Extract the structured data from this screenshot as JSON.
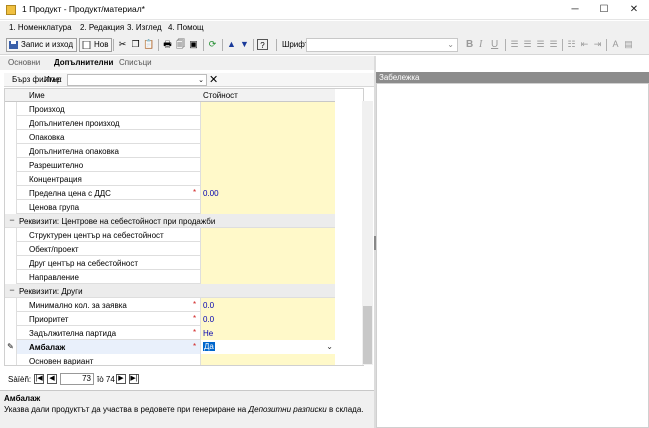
{
  "window": {
    "title": "1 Продукт - Продукт/материал*",
    "minimize": "─",
    "maximize": "☐",
    "close": "✕"
  },
  "menu": [
    {
      "label": "1. Номенклатура"
    },
    {
      "label": "2. Редакция"
    },
    {
      "label": "3. Изглед"
    },
    {
      "label": "4. Помощ"
    }
  ],
  "toolbar": {
    "save_exit": "Запис и изход",
    "new": "Нов",
    "font_label": "Шрифт:",
    "font_value": "",
    "fmt": [
      "B",
      "I",
      "U"
    ]
  },
  "tabs": [
    {
      "label": "Основни",
      "active": false
    },
    {
      "label": "Допълнителни",
      "active": true
    },
    {
      "label": "Списъци",
      "active": false
    }
  ],
  "filter": {
    "quick_filter": "Бърз филтър",
    "name_label": "Име:",
    "name_value": ""
  },
  "grid": {
    "columns": [
      "Име",
      "Стойност"
    ],
    "rows": [
      {
        "type": "item",
        "name": "Произход",
        "required": false,
        "value": ""
      },
      {
        "type": "item",
        "name": "Допълнителен произход",
        "required": false,
        "value": ""
      },
      {
        "type": "item",
        "name": "Опаковка",
        "required": false,
        "value": ""
      },
      {
        "type": "item",
        "name": "Допълнителна опаковка",
        "required": false,
        "value": ""
      },
      {
        "type": "item",
        "name": "Разрешително",
        "required": false,
        "value": ""
      },
      {
        "type": "item",
        "name": "Концентрация",
        "required": false,
        "value": ""
      },
      {
        "type": "item",
        "name": "Пределна цена с ДДС",
        "required": true,
        "value": "0.00"
      },
      {
        "type": "item",
        "name": "Ценова група",
        "required": false,
        "value": ""
      },
      {
        "type": "group",
        "name": "Реквизити: Центрове на себестойност при продажби",
        "toggle": "−"
      },
      {
        "type": "item",
        "name": "Структурен център на себестойност",
        "required": false,
        "value": ""
      },
      {
        "type": "item",
        "name": "Обект/проект",
        "required": false,
        "value": ""
      },
      {
        "type": "item",
        "name": "Друг център на себестойност",
        "required": false,
        "value": ""
      },
      {
        "type": "item",
        "name": "Направление",
        "required": false,
        "value": ""
      },
      {
        "type": "group",
        "name": "Реквизити: Други",
        "toggle": "−"
      },
      {
        "type": "item",
        "name": "Минимално кол. за заявка",
        "required": true,
        "value": "0.0"
      },
      {
        "type": "item",
        "name": "Приоритет",
        "required": true,
        "value": "0.0"
      },
      {
        "type": "item",
        "name": "Задължителна партида",
        "required": true,
        "value": "Не"
      },
      {
        "type": "item",
        "name": "Амбалаж",
        "required": true,
        "value": "Да",
        "selected": true,
        "indicator": "✎"
      },
      {
        "type": "item",
        "name": "Основен вариант",
        "required": false,
        "value": ""
      }
    ],
    "required_mark": "*",
    "dropdown_arrow": "⌄"
  },
  "nav": {
    "label": "Ѕàïèñ:",
    "current": "73",
    "of_text": "îò 74"
  },
  "description": {
    "title": "Амбалаж",
    "text_before": "Указва дали продуктът да участва в редовете при генериране на ",
    "text_italic": "Депозитни разписки",
    "text_after": " в склада."
  },
  "note": {
    "title": "Забележка"
  }
}
